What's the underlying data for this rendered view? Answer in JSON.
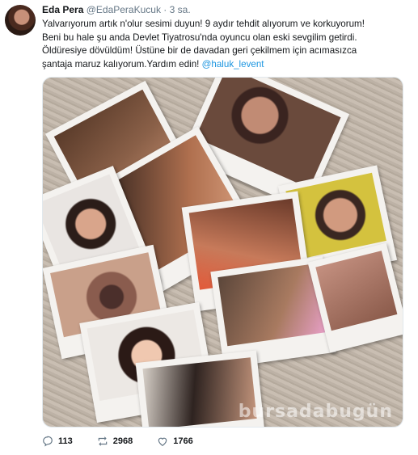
{
  "tweet": {
    "name": "Eda Pera",
    "handle": "@EdaPeraKucuk",
    "separator": "·",
    "time": "3 sa.",
    "lines": [
      "Yalvarıyorum artık n'olur sesimi duyun! 9 aydır tehdit alıyorum ve korkuyorum!",
      "Beni bu hale şu anda Devlet Tiyatrosu'nda oyuncu olan eski sevgilim getirdi.",
      "Öldüresiye dövüldüm! Üstüne bir de davadan geri çekilmem için acımasızca",
      "şantaja maruz kalıyorum.Yardım edin!"
    ],
    "mention": "@haluk_levent"
  },
  "photo": {
    "watermark": "bursadabugün"
  },
  "actions": {
    "replies": "113",
    "retweets": "2968",
    "likes": "1766"
  },
  "icons": {
    "reply": "reply-icon",
    "retweet": "retweet-icon",
    "like": "heart-icon"
  }
}
